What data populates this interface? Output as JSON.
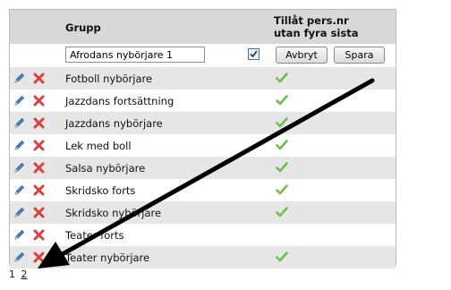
{
  "header": {
    "group_label": "Grupp",
    "allow_label_line1": "Tillåt pers.nr",
    "allow_label_line2": "utan fyra sista"
  },
  "edit_row": {
    "name_value": "Afrodans nybörjare 1",
    "allow_checked": true,
    "cancel_label": "Avbryt",
    "save_label": "Spara"
  },
  "rows": [
    {
      "name": "Fotboll nybörjare",
      "allowed": true
    },
    {
      "name": "Jazzdans fortsättning",
      "allowed": true
    },
    {
      "name": "Jazzdans nybörjare",
      "allowed": true
    },
    {
      "name": "Lek med boll",
      "allowed": true
    },
    {
      "name": "Salsa nybörjare",
      "allowed": true
    },
    {
      "name": "Skridsko forts",
      "allowed": true
    },
    {
      "name": "Skridsko nybörjare",
      "allowed": true
    },
    {
      "name": "Teater forts",
      "allowed": false
    },
    {
      "name": "Teater nybörjare",
      "allowed": true
    }
  ],
  "pager": {
    "current": "1",
    "next": "2"
  },
  "colors": {
    "header_bg": "#d8d8d8",
    "alt_row_bg": "#e6e6e6",
    "check_green": "#6cc04a",
    "delete_red": "#d84040",
    "pencil_blue": "#4a86c8",
    "annotation_arrow": "#000000"
  },
  "icons": {
    "edit": "pencil-icon",
    "delete": "delete-x-icon",
    "allowed": "checkmark-icon"
  }
}
